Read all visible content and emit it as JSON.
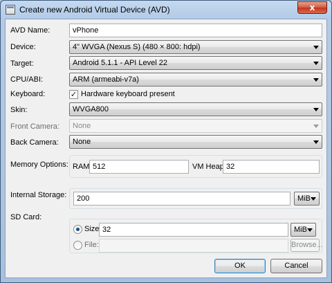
{
  "window": {
    "title": "Create new Android Virtual Device (AVD)",
    "close_glyph": "x"
  },
  "form": {
    "avd_name": {
      "label": "AVD Name:",
      "value": "vPhone"
    },
    "device": {
      "label": "Device:",
      "value": "4\" WVGA (Nexus S) (480 × 800: hdpi)"
    },
    "target": {
      "label": "Target:",
      "value": "Android 5.1.1 - API Level 22"
    },
    "cpu_abi": {
      "label": "CPU/ABI:",
      "value": "ARM (armeabi-v7a)"
    },
    "keyboard": {
      "label": "Keyboard:",
      "checkbox_label": "Hardware keyboard present",
      "checked": true,
      "check_glyph": "✓"
    },
    "skin": {
      "label": "Skin:",
      "value": "WVGA800"
    },
    "front_camera": {
      "label": "Front Camera:",
      "value": "None"
    },
    "back_camera": {
      "label": "Back Camera:",
      "value": "None"
    },
    "memory": {
      "label": "Memory Options:",
      "ram_label": "RAM:",
      "ram_value": "512",
      "vm_heap_label": "VM Heap:",
      "vm_heap_value": "32"
    },
    "internal_storage": {
      "label": "Internal Storage:",
      "value": "200",
      "unit": "MiB"
    },
    "sd_card": {
      "label": "SD Card:",
      "size_label": "Size:",
      "size_value": "32",
      "size_unit": "MiB",
      "size_selected": true,
      "file_label": "File:",
      "file_value": "",
      "browse_label": "Browse..."
    }
  },
  "buttons": {
    "ok": "OK",
    "cancel": "Cancel"
  },
  "colors": {
    "close_button": "#c1371c",
    "title_bar": "#b3cbe6",
    "dialog_bg": "#f0f0f0"
  }
}
